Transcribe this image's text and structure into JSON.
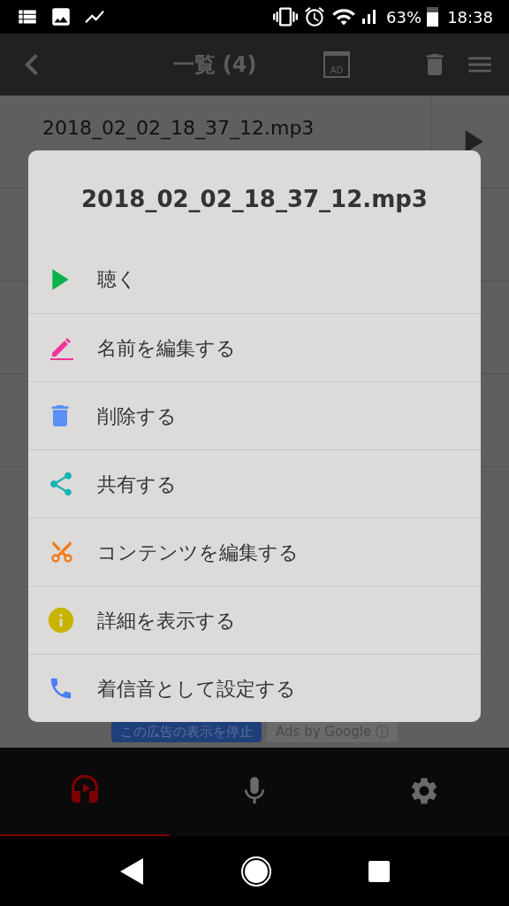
{
  "status_bar": {
    "battery": "63%",
    "time": "18:38"
  },
  "header": {
    "title": "一覧 (4)",
    "ad_badge": "AD"
  },
  "list": {
    "rows": [
      {
        "name": "2018_02_02_18_37_12.mp3"
      }
    ]
  },
  "ad_buttons": [
    "この広告の表示を停止",
    "Ads by Google ⓘ"
  ],
  "dialog": {
    "title": "2018_02_02_18_37_12.mp3",
    "items": [
      {
        "kind": "play",
        "label": "聴く"
      },
      {
        "kind": "rename",
        "label": "名前を編集する"
      },
      {
        "kind": "delete",
        "label": "削除する"
      },
      {
        "kind": "share",
        "label": "共有する"
      },
      {
        "kind": "cut",
        "label": "コンテンツを編集する"
      },
      {
        "kind": "info",
        "label": "詳細を表示する"
      },
      {
        "kind": "ringtone",
        "label": "着信音として設定する"
      }
    ]
  },
  "bottom_nav": [
    {
      "kind": "player",
      "selected": true
    },
    {
      "kind": "record",
      "selected": false
    },
    {
      "kind": "settings",
      "selected": false
    }
  ]
}
